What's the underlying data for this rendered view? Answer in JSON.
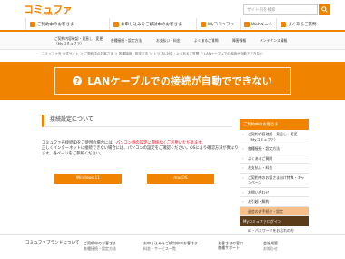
{
  "header": {
    "logo": "コミュファ",
    "logo_sub": "COMMUFA",
    "search_placeholder": "サイト内を検索"
  },
  "nav": {
    "items": [
      {
        "label": "ご契約中のお客さま",
        "icon": "user-icon"
      },
      {
        "label": "お申し込みをご検討中のお客さま",
        "icon": "cart-icon"
      },
      {
        "label": "Myコミュファ",
        "icon": "home-icon"
      },
      {
        "label": "Webメール",
        "icon": "mail-icon"
      },
      {
        "label": "よくあるご質問",
        "icon": "question-icon"
      }
    ]
  },
  "subnav": {
    "items": [
      {
        "line1": "ご契約内容確認・見直し・変更",
        "line2": "（Myコミュファ）"
      },
      {
        "line1": "各種接続・設定方法",
        "line2": ""
      },
      {
        "line1": "お支払い・料金",
        "line2": ""
      },
      {
        "line1": "よくあるご質問",
        "line2": ""
      },
      {
        "line1": "障害情報",
        "line2": ""
      },
      {
        "line1": "メンテナンス情報",
        "line2": ""
      }
    ]
  },
  "breadcrumb": "コミュファ光 公式サイト ＞ ご契約中のお客さま ＞ 各種接続・設定方法 ＞ トラブル対応・よくあるご質問 ＞ LANケーブルでの接続が自動でできない",
  "hero": {
    "title": "LANケーブルでの接続が自動でできない"
  },
  "section": {
    "heading": "接続設定について"
  },
  "content": {
    "line1_a": "コミュファ光接続IDをご使用の場合には、",
    "line1_b": "パソコン側の設定に関係なくご利用いただけます。",
    "line2": "正しくインターネットに接続できない場合には、パソコンの設定をご確認ください。OSにより確認方法が異なり",
    "line3": "ます。各ページをご参照ください。"
  },
  "os_buttons": {
    "windows": "Windows 11",
    "mac": "macOS"
  },
  "side_menu": {
    "head": "ご契約中のお客さま",
    "items": [
      "ご契約内容確認・見直し・変更（Myコミュファ）",
      "各種接続・設定方法",
      "よくあるご質問",
      "お支払い・料金",
      "ご契約中のお客さま向け特典・キャンペーン",
      "お問い合わせ",
      "お引越・解約"
    ],
    "active_item": "退会のお手続き・設定",
    "dark_item": "Myコミュファログイン",
    "extra_items": [
      "ID・パスワードをお忘れの方",
      "Myコミュファの使い方"
    ]
  },
  "footer": {
    "brand": "コミュファブランドについて",
    "col1": "ご契約中のお客さま",
    "col2": "お申し込みをご検討中のお客さま",
    "col3_line1": "お客さまの窓口",
    "col3_line2": "各種サポート",
    "col4": "会社概要",
    "col1_sub": "各種接続・設定方法",
    "col2_sub": "料金・サービス一覧",
    "col3_sub": "よくあるご質問",
    "col4_sub": "お知らせ"
  },
  "colors": {
    "brand_orange": "#f08300",
    "alert_red": "#e60012",
    "menu_dark": "#5a3b1a"
  }
}
